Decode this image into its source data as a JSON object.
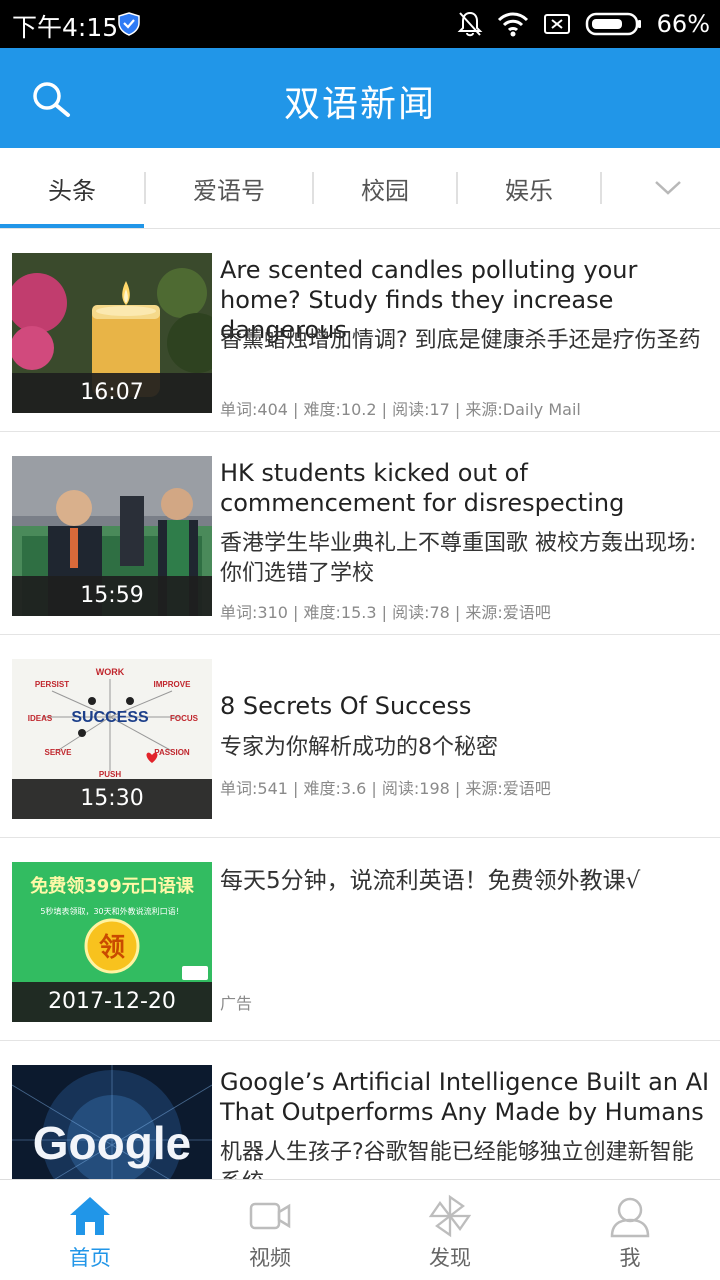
{
  "status_bar": {
    "time": "下午4:15",
    "battery_percent": "66%"
  },
  "header": {
    "title": "双语新闻"
  },
  "tabs": [
    {
      "label": "头条",
      "active": true
    },
    {
      "label": "爱语号",
      "active": false
    },
    {
      "label": "校园",
      "active": false
    },
    {
      "label": "娱乐",
      "active": false
    }
  ],
  "news": [
    {
      "en_title": "Are scented candles polluting your home? Study finds they increase dangerous",
      "zh_title": "香薰蜡烛增加情调? 到底是健康杀手还是疗伤圣药",
      "meta": "单词:404 | 难度:10.2 | 阅读:17 | 来源:Daily Mail",
      "duration": "16:07",
      "thumb_icon": "candle-thumbnail"
    },
    {
      "en_title": "HK students kicked out of commencement for disrespecting",
      "zh_title": "香港学生毕业典礼上不尊重国歌 被校方轰出现场:你们选错了学校",
      "meta": "单词:310 | 难度:15.3 | 阅读:78 | 来源:爱语吧",
      "duration": "15:59",
      "thumb_icon": "ceremony-thumbnail"
    },
    {
      "en_title": "8 Secrets Of Success",
      "zh_title": "专家为你解析成功的8个秘密",
      "meta": "单词:541 | 难度:3.6 | 阅读:198 | 来源:爱语吧",
      "duration": "15:30",
      "thumb_icon": "success-diagram-thumbnail",
      "thumb_text": {
        "center": "SUCCESS",
        "work": "WORK",
        "persist": "PERSIST",
        "improve": "IMPROVE",
        "ideas": "IDEAS",
        "focus": "FOCUS",
        "serve": "SERVE",
        "passion": "PASSION",
        "push": "PUSH"
      }
    },
    {
      "en_title": "",
      "zh_title": "每天5分钟，说流利英语！免费领外教课√",
      "meta": "广告",
      "duration": "2017-12-20",
      "thumb_icon": "ad-thumbnail",
      "thumb_text": {
        "headline": "免费领399元口语课",
        "sub": "5秒填表领取，30天和外教说流利口语！",
        "badge": "领"
      }
    },
    {
      "en_title": "Google’s Artificial Intelligence Built an AI That Outperforms Any Made by Humans",
      "zh_title": "机器人生孩子?谷歌智能已经能够独立创建新智能系统",
      "meta": "",
      "duration": "",
      "thumb_icon": "google-thumbnail",
      "thumb_text": {
        "logo": "Google"
      }
    }
  ],
  "bottom_nav": [
    {
      "label": "首页",
      "icon": "home-icon",
      "active": true
    },
    {
      "label": "视频",
      "icon": "video-icon",
      "active": false
    },
    {
      "label": "发现",
      "icon": "pinwheel-icon",
      "active": false
    },
    {
      "label": "我",
      "icon": "profile-icon",
      "active": false
    }
  ],
  "colors": {
    "accent": "#2196e8",
    "status_bar": "#000000"
  }
}
